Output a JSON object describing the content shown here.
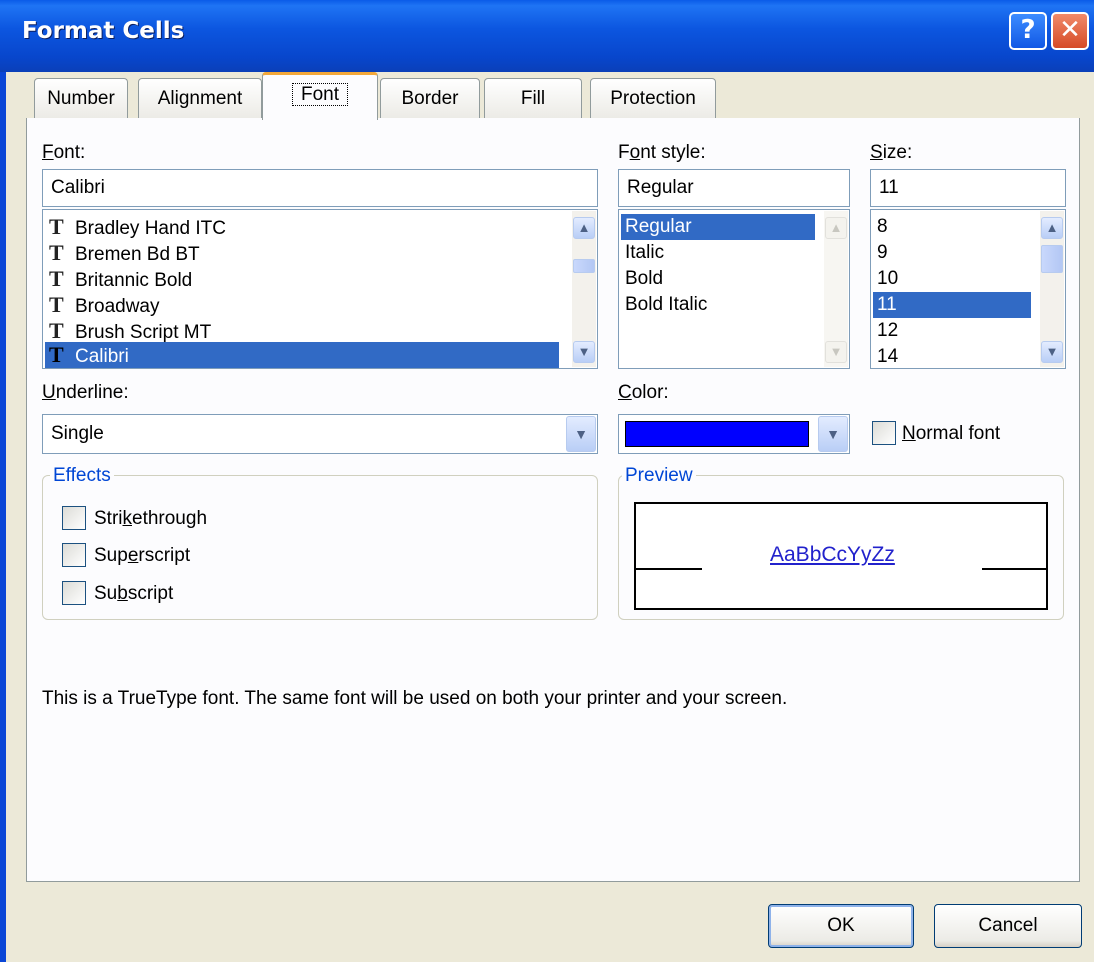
{
  "window": {
    "title": "Format Cells",
    "help_glyph": "?",
    "close_glyph": "✕"
  },
  "tabs": [
    {
      "label": "Number"
    },
    {
      "label": "Alignment"
    },
    {
      "label": "Font"
    },
    {
      "label": "Border"
    },
    {
      "label": "Fill"
    },
    {
      "label": "Protection"
    }
  ],
  "font": {
    "label_first": "F",
    "label_rest": "ont:",
    "value": "Calibri",
    "items": [
      "Bradley Hand ITC",
      "Bremen Bd BT",
      "Britannic Bold",
      "Broadway",
      "Brush Script MT",
      "Calibri"
    ],
    "selected": "Calibri",
    "item_icon": "truetype-icon"
  },
  "style": {
    "label_a": "F",
    "label_b": "o",
    "label_c": "nt style:",
    "value": "Regular",
    "items": [
      "Regular",
      "Italic",
      "Bold",
      "Bold Italic"
    ],
    "selected": "Regular"
  },
  "size": {
    "label_first": "S",
    "label_rest": "ize:",
    "value": "11",
    "items": [
      "8",
      "9",
      "10",
      "11",
      "12",
      "14"
    ],
    "selected": "11"
  },
  "underline": {
    "label_first": "U",
    "label_rest": "nderline:",
    "value": "Single"
  },
  "color": {
    "label_first": "C",
    "label_rest": "olor:",
    "swatch": "#0000ff"
  },
  "normal_font": {
    "label_first": "N",
    "label_rest": "ormal font",
    "checked": false
  },
  "effects": {
    "title": "Effects",
    "strikethrough": {
      "a": "Stri",
      "u": "k",
      "b": "ethrough",
      "checked": false
    },
    "superscript": {
      "a": "Sup",
      "u": "e",
      "b": "rscript",
      "checked": false
    },
    "subscript": {
      "a": "Su",
      "u": "b",
      "b": "script",
      "checked": false
    }
  },
  "preview": {
    "title": "Preview",
    "sample": "AaBbCcYyZz"
  },
  "info": "This is a TrueType font.  The same font will be used on both your printer and your screen.",
  "buttons": {
    "ok": "OK",
    "cancel": "Cancel"
  }
}
